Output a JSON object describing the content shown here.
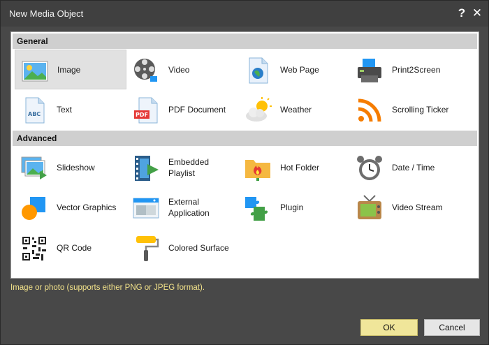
{
  "window": {
    "title": "New Media Object"
  },
  "sections": {
    "general": {
      "label": "General"
    },
    "advanced": {
      "label": "Advanced"
    }
  },
  "general_items": [
    {
      "label": "Image",
      "icon": "image-icon",
      "selected": true
    },
    {
      "label": "Video",
      "icon": "film-reel-icon"
    },
    {
      "label": "Web Page",
      "icon": "globe-document-icon"
    },
    {
      "label": "Print2Screen",
      "icon": "printer-icon"
    },
    {
      "label": "Text",
      "icon": "text-document-icon"
    },
    {
      "label": "PDF Document",
      "icon": "pdf-document-icon"
    },
    {
      "label": "Weather",
      "icon": "sun-cloud-icon"
    },
    {
      "label": "Scrolling Ticker",
      "icon": "rss-icon"
    }
  ],
  "advanced_items": [
    {
      "label": "Slideshow",
      "icon": "slideshow-icon"
    },
    {
      "label": "Embedded Playlist",
      "icon": "playlist-icon"
    },
    {
      "label": "Hot Folder",
      "icon": "hot-folder-icon"
    },
    {
      "label": "Date / Time",
      "icon": "alarm-clock-icon"
    },
    {
      "label": "Vector Graphics",
      "icon": "vector-shapes-icon"
    },
    {
      "label": "External Application",
      "icon": "application-window-icon"
    },
    {
      "label": "Plugin",
      "icon": "puzzle-icon"
    },
    {
      "label": "Video Stream",
      "icon": "tv-icon"
    },
    {
      "label": "QR Code",
      "icon": "qr-code-icon"
    },
    {
      "label": "Colored Surface",
      "icon": "paint-roller-icon"
    }
  ],
  "description": "Image or photo (supports either PNG or JPEG format).",
  "buttons": {
    "ok": "OK",
    "cancel": "Cancel"
  },
  "colors": {
    "accent_yellow": "#f0e69a",
    "description_text": "#f2e28a",
    "selection": "#e1e1e1"
  }
}
